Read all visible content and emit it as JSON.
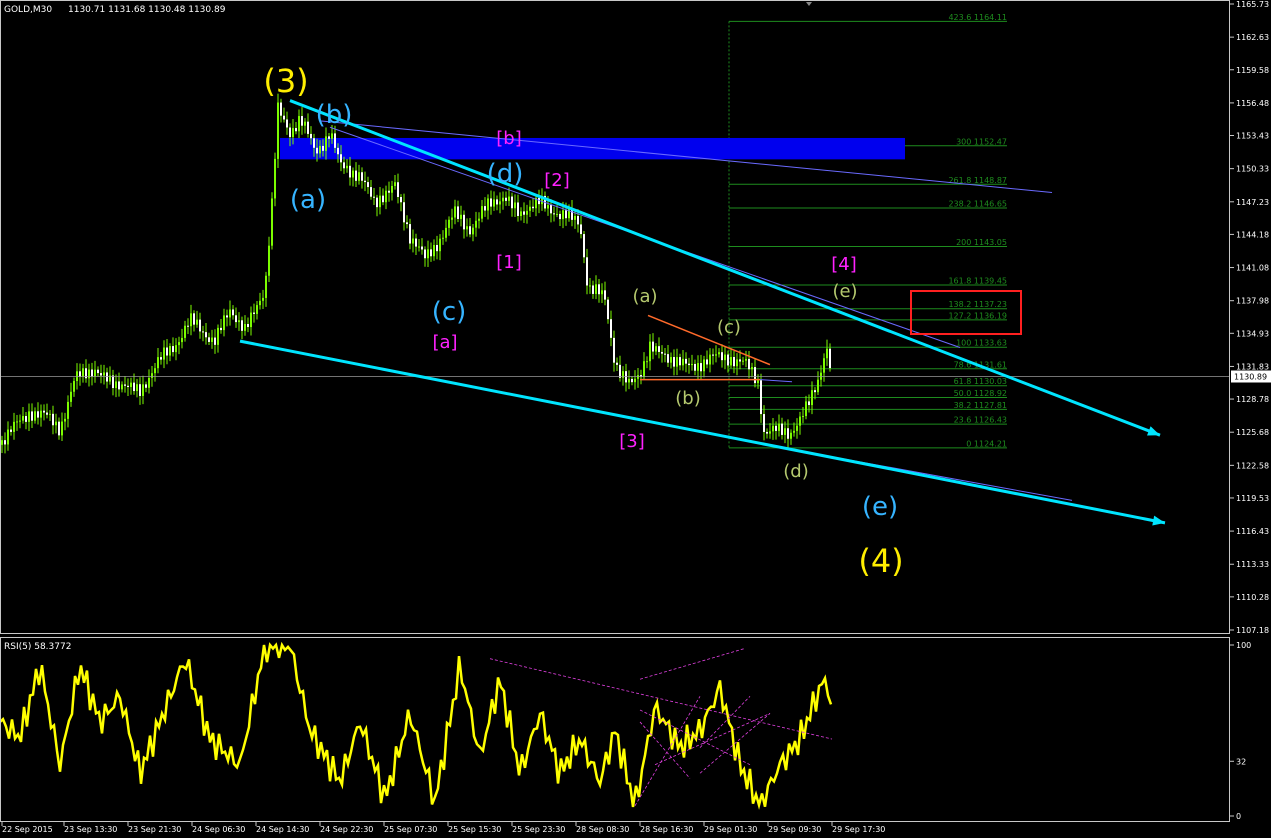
{
  "colors": {
    "background": "#000000",
    "grid_border": "#c8c8c8",
    "bull_candle": "#7CFC00",
    "bear_candle": "#ffffff",
    "channel": "#00e5ff",
    "thin_line": "#6a6aff",
    "supply_zone": "#0000ee",
    "fib": "#1e8c1e",
    "rsi": "#ffff00",
    "rsi_trend": "#e040e0",
    "orange": "#ff6a2a",
    "label_yellow": "#ffee00",
    "label_cyan": "#36b4ff",
    "label_magenta": "#ff22ff",
    "label_olive": "#b4c86e",
    "box": "#ff2020"
  },
  "header": {
    "symbol": "GOLD,M30",
    "ohlc": "1130.71 1131.68 1130.48 1130.89"
  },
  "rsi_header": {
    "text": "RSI(5) 58.3772"
  },
  "current_price": "1130.89",
  "price_axis": [
    "1165.73",
    "1162.63",
    "1159.58",
    "1156.48",
    "1153.43",
    "1150.33",
    "1147.23",
    "1144.18",
    "1141.08",
    "1137.98",
    "1134.93",
    "1131.83",
    "1128.78",
    "1125.68",
    "1122.58",
    "1119.53",
    "1116.43",
    "1113.33",
    "1110.28",
    "1107.18"
  ],
  "rsi_axis": [
    "100",
    "32",
    "0"
  ],
  "time_axis": [
    "22 Sep 2015",
    "23 Sep 13:30",
    "23 Sep 21:30",
    "24 Sep 06:30",
    "24 Sep 14:30",
    "24 Sep 22:30",
    "25 Sep 07:30",
    "25 Sep 15:30",
    "25 Sep 23:30",
    "28 Sep 08:30",
    "28 Sep 16:30",
    "29 Sep 01:30",
    "29 Sep 09:30",
    "29 Sep 17:30"
  ],
  "fib_levels": [
    {
      "label": "423.6 1164.11",
      "price": 1164.11
    },
    {
      "label": "300 1152.47",
      "price": 1152.47
    },
    {
      "label": "261.8 1148.87",
      "price": 1148.87
    },
    {
      "label": "238.2 1146.65",
      "price": 1146.65
    },
    {
      "label": "200 1143.05",
      "price": 1143.05
    },
    {
      "label": "161.8 1139.45",
      "price": 1139.45
    },
    {
      "label": "138.2 1137.23",
      "price": 1137.23
    },
    {
      "label": "127.2 1136.19",
      "price": 1136.19
    },
    {
      "label": "100 1133.63",
      "price": 1133.63
    },
    {
      "label": "78.6 1131.61",
      "price": 1131.61
    },
    {
      "label": "61.8 1130.03",
      "price": 1130.03
    },
    {
      "label": "50.0 1128.92",
      "price": 1128.92
    },
    {
      "label": "38.2 1127.81",
      "price": 1127.81
    },
    {
      "label": "23.6 1126.43",
      "price": 1126.43
    },
    {
      "label": "0 1124.21",
      "price": 1124.21
    }
  ],
  "wave_labels": [
    {
      "text": "(3)",
      "color": "yellow",
      "size": "xl"
    },
    {
      "text": "(4)",
      "color": "yellow",
      "size": "xl"
    },
    {
      "text": "(a)",
      "color": "cyan",
      "size": "l"
    },
    {
      "text": "(b)",
      "color": "cyan",
      "size": "l"
    },
    {
      "text": "(c)",
      "color": "cyan",
      "size": "l"
    },
    {
      "text": "(d)",
      "color": "cyan",
      "size": "l"
    },
    {
      "text": "(e)",
      "color": "cyan",
      "size": "l"
    },
    {
      "text": "[b]",
      "color": "magenta",
      "size": "m"
    },
    {
      "text": "[2]",
      "color": "magenta",
      "size": "m"
    },
    {
      "text": "[1]",
      "color": "magenta",
      "size": "m"
    },
    {
      "text": "[a]",
      "color": "magenta",
      "size": "m"
    },
    {
      "text": "[3]",
      "color": "magenta",
      "size": "m"
    },
    {
      "text": "[4]",
      "color": "magenta",
      "size": "m"
    },
    {
      "text": "(a)",
      "color": "olive",
      "size": "m"
    },
    {
      "text": "(b)",
      "color": "olive",
      "size": "m"
    },
    {
      "text": "(c)",
      "color": "olive",
      "size": "m"
    },
    {
      "text": "(d)",
      "color": "olive",
      "size": "m"
    },
    {
      "text": "(e)",
      "color": "olive",
      "size": "m"
    }
  ],
  "chart_data": {
    "type": "candlestick",
    "symbol": "GOLD",
    "timeframe": "M30",
    "ylim": [
      1105.6,
      1167.3
    ],
    "close_path": [
      [
        0,
        1124.5
      ],
      [
        30,
        1127.8
      ],
      [
        60,
        1126.2
      ],
      [
        75,
        1130.6
      ],
      [
        95,
        1131.6
      ],
      [
        115,
        1130.1
      ],
      [
        140,
        1129.7
      ],
      [
        165,
        1132.9
      ],
      [
        190,
        1135.9
      ],
      [
        215,
        1134.4
      ],
      [
        230,
        1136.9
      ],
      [
        245,
        1135.4
      ],
      [
        265,
        1138.9
      ],
      [
        272,
        1146.9
      ],
      [
        278,
        1155.9
      ],
      [
        290,
        1153.9
      ],
      [
        300,
        1154.9
      ],
      [
        315,
        1151.9
      ],
      [
        330,
        1153.9
      ],
      [
        340,
        1150.4
      ],
      [
        360,
        1149.9
      ],
      [
        375,
        1146.9
      ],
      [
        395,
        1148.9
      ],
      [
        410,
        1143.9
      ],
      [
        425,
        1141.9
      ],
      [
        440,
        1143.9
      ],
      [
        455,
        1145.9
      ],
      [
        470,
        1144.9
      ],
      [
        490,
        1146.9
      ],
      [
        505,
        1147.9
      ],
      [
        520,
        1145.9
      ],
      [
        540,
        1147.4
      ],
      [
        560,
        1145.9
      ],
      [
        580,
        1145.4
      ],
      [
        588,
        1139.4
      ],
      [
        605,
        1137.9
      ],
      [
        615,
        1132.4
      ],
      [
        630,
        1129.9
      ],
      [
        640,
        1130.9
      ],
      [
        650,
        1133.9
      ],
      [
        670,
        1132.4
      ],
      [
        690,
        1131.9
      ],
      [
        710,
        1132.4
      ],
      [
        730,
        1132.9
      ],
      [
        745,
        1131.9
      ],
      [
        758,
        1130.4
      ],
      [
        764,
        1125.9
      ],
      [
        775,
        1125.9
      ],
      [
        790,
        1125.4
      ],
      [
        800,
        1126.9
      ],
      [
        810,
        1128.9
      ],
      [
        820,
        1130.9
      ],
      [
        826,
        1133.4
      ],
      [
        832,
        1130.9
      ]
    ],
    "last_close": 1130.89,
    "channel_upper": [
      [
        290,
        1156.7
      ],
      [
        1160,
        1125.4
      ]
    ],
    "channel_lower": [
      [
        240,
        1134.2
      ],
      [
        1165,
        1117.2
      ]
    ],
    "supply_zone": {
      "x": [
        280,
        905
      ],
      "y": [
        1151.2,
        1153.2
      ]
    },
    "rsi": {
      "period": 5,
      "value": 58.3772,
      "ylim": [
        0,
        100
      ],
      "path": [
        [
          0,
          55
        ],
        [
          20,
          46
        ],
        [
          40,
          88
        ],
        [
          60,
          30
        ],
        [
          80,
          88
        ],
        [
          100,
          55
        ],
        [
          120,
          70
        ],
        [
          140,
          25
        ],
        [
          160,
          55
        ],
        [
          185,
          92
        ],
        [
          210,
          45
        ],
        [
          240,
          30
        ],
        [
          265,
          100
        ],
        [
          290,
          100
        ],
        [
          310,
          50
        ],
        [
          340,
          20
        ],
        [
          360,
          55
        ],
        [
          385,
          10
        ],
        [
          410,
          60
        ],
        [
          435,
          8
        ],
        [
          460,
          88
        ],
        [
          480,
          35
        ],
        [
          500,
          80
        ],
        [
          520,
          25
        ],
        [
          540,
          60
        ],
        [
          560,
          25
        ],
        [
          580,
          45
        ],
        [
          600,
          20
        ],
        [
          615,
          50
        ],
        [
          635,
          6
        ],
        [
          655,
          64
        ],
        [
          680,
          40
        ],
        [
          700,
          50
        ],
        [
          720,
          75
        ],
        [
          740,
          30
        ],
        [
          760,
          6
        ],
        [
          780,
          30
        ],
        [
          800,
          45
        ],
        [
          820,
          75
        ],
        [
          827,
          80
        ],
        [
          832,
          58
        ]
      ]
    }
  }
}
